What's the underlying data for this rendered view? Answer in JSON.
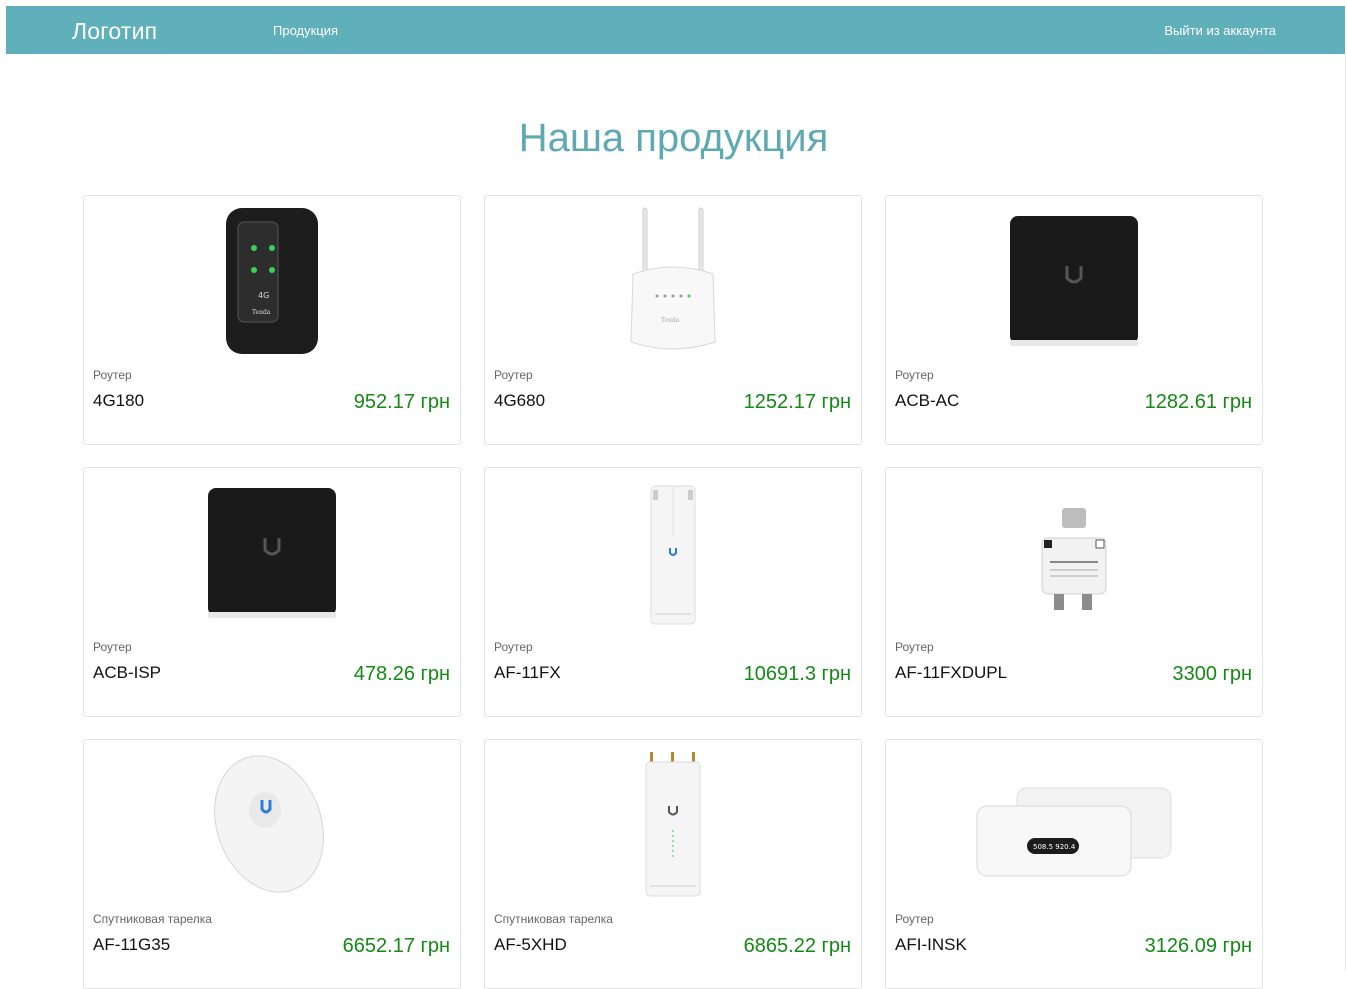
{
  "navbar": {
    "brand": "Логотип",
    "products_link": "Продукция",
    "logout_link": "Выйти из аккаунта",
    "background": "#5fb0bb"
  },
  "main": {
    "title": "Наша продукция"
  },
  "products": [
    {
      "category": "Роутер",
      "name": "4G180",
      "price": "952.17 грн",
      "icon": "mobile-router-4g-icon"
    },
    {
      "category": "Роутер",
      "name": "4G680",
      "price": "1252.17 грн",
      "icon": "router-with-antennas-icon"
    },
    {
      "category": "Роутер",
      "name": "ACB-AC",
      "price": "1282.61 грн",
      "icon": "black-cube-access-point-icon"
    },
    {
      "category": "Роутер",
      "name": "ACB-ISP",
      "price": "478.26 грн",
      "icon": "black-cube-access-point-icon"
    },
    {
      "category": "Роутер",
      "name": "AF-11FX",
      "price": "10691.3 грн",
      "icon": "airfiber-radio-icon"
    },
    {
      "category": "Роутер",
      "name": "AF-11FXDUPL",
      "price": "3300 грн",
      "icon": "duplexer-icon"
    },
    {
      "category": "Спутниковая тарелка",
      "name": "AF-11G35",
      "price": "6652.17 грн",
      "icon": "satellite-dish-icon"
    },
    {
      "category": "Спутниковая тарелка",
      "name": "AF-5XHD",
      "price": "6865.22 грн",
      "icon": "airfiber-radio-tall-icon"
    },
    {
      "category": "Роутер",
      "name": "AFI-INSK",
      "price": "3126.09 грн",
      "icon": "amplifi-instant-icon"
    }
  ],
  "colors": {
    "accent": "#5fb0bb",
    "title": "#5fa9b3",
    "price": "#138a13"
  }
}
